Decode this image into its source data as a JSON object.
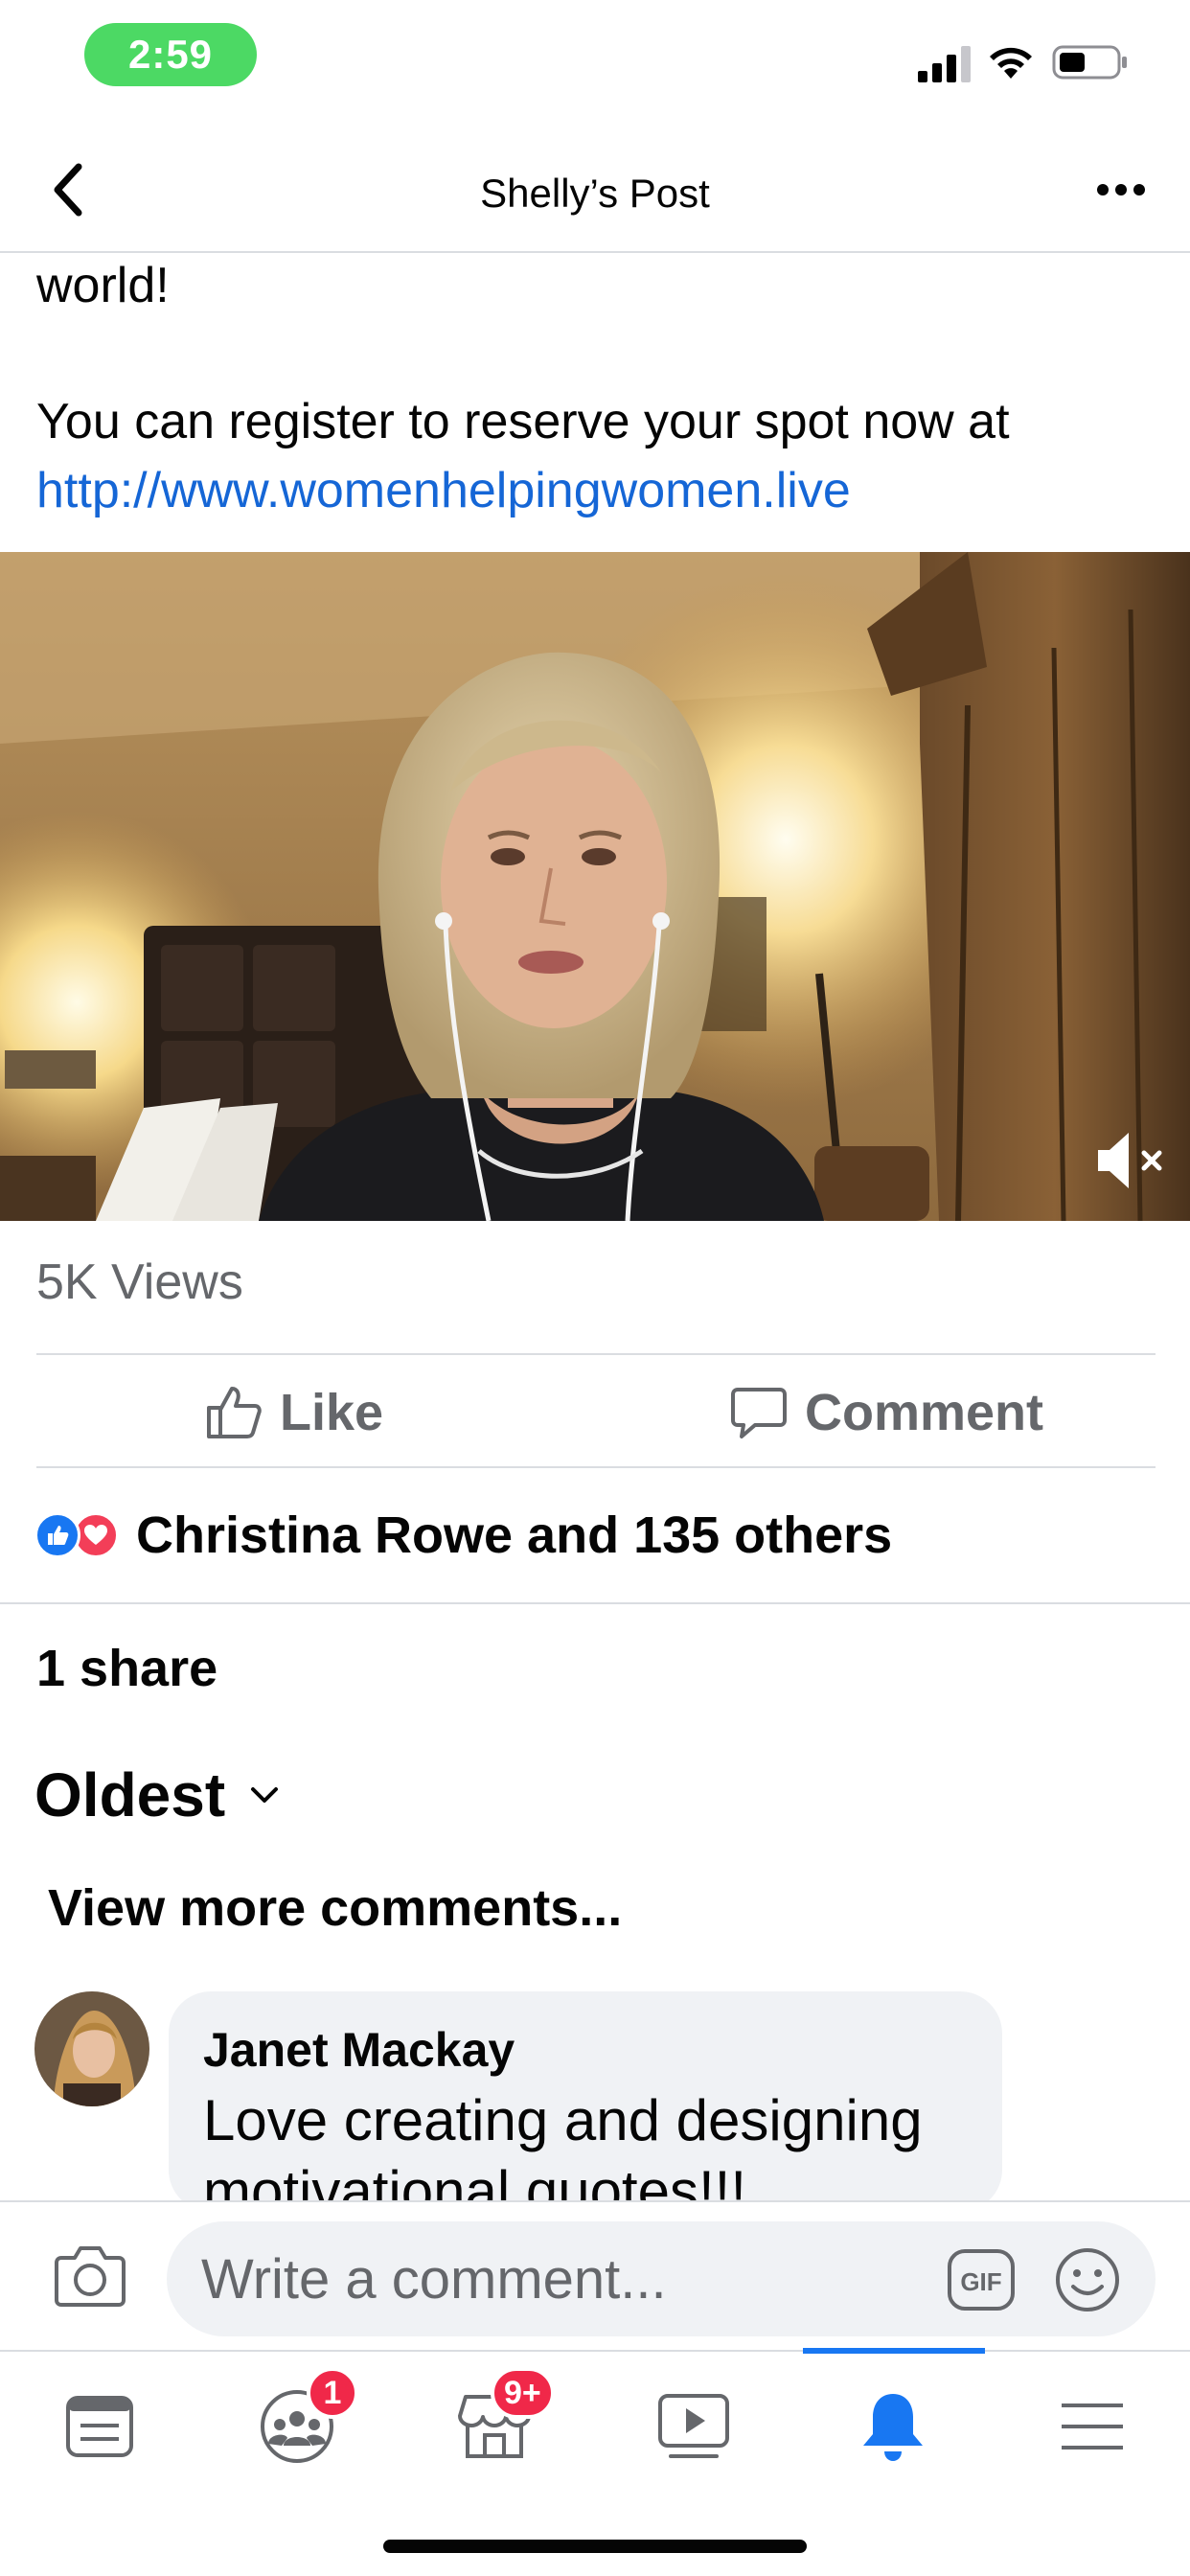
{
  "status_bar": {
    "time": "2:59"
  },
  "header": {
    "title": "Shelly’s Post"
  },
  "post": {
    "text_lines": [
      "world!",
      "You can register to reserve your spot now at"
    ],
    "link": "http://www.womenhelpingwomen.live"
  },
  "stats": {
    "views": "5K Views",
    "reactions_text": "Christina Rowe and 135 others",
    "shares": "1 share"
  },
  "actions": {
    "like_label": "Like",
    "comment_label": "Comment"
  },
  "comments": {
    "sort_label": "Oldest",
    "view_more_label": "View more comments...",
    "items": [
      {
        "author": "Janet Mackay",
        "text": "Love creating and designing motivational quotes!!!"
      }
    ]
  },
  "composer": {
    "placeholder": "Write a comment...",
    "gif_label": "GIF"
  },
  "tabbar": {
    "groups_badge": "1",
    "marketplace_badge": "9+"
  },
  "colors": {
    "accent": "#1877f2",
    "link": "#1566d6",
    "status_pill": "#4cd964",
    "badge": "#f02849"
  }
}
